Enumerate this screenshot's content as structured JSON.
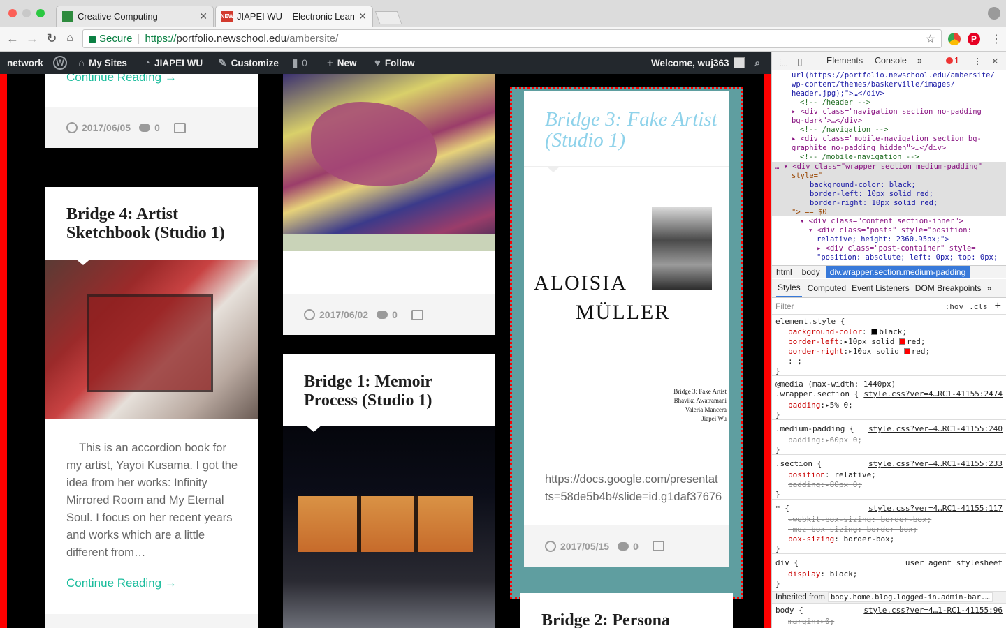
{
  "browser": {
    "tabs": [
      {
        "title": "Creative Computing",
        "favicon_color": "#2e8b3e"
      },
      {
        "title": "JIAPEI WU – Electronic Learning",
        "favicon_text": "NEW",
        "favicon_color": "#d23b2e"
      }
    ],
    "secure_label": "Secure",
    "url_prefix": "https://",
    "url_host": "portfolio.newschool.edu",
    "url_path": "/ambersite/"
  },
  "adminbar": {
    "items": {
      "network": "network",
      "my_sites": "My Sites",
      "site_name": "JIAPEI WU",
      "customize": "Customize",
      "comments_count": "0",
      "new": "New",
      "follow": "Follow"
    },
    "welcome": "Welcome, wuj363"
  },
  "posts": {
    "col1_top": {
      "continue": "Continue Reading →",
      "date": "2017/06/05",
      "comments": "0"
    },
    "bridge4": {
      "title": "Bridge 4: Artist Sketchbook (Studio 1)",
      "excerpt": "This is an accordion book for my artist, Yayoi Kusama. I got the idea from her works: Infinity Mirrored Room and My Eternal Soul. I focus on her recent years and works which are a little different from…",
      "continue": "Continue Reading →"
    },
    "col2_top": {
      "date": "2017/06/02",
      "comments": "0"
    },
    "bridge1": {
      "title": "Bridge 1: Memoir Process (Studio 1)"
    },
    "bridge3": {
      "title": "Bridge 3: Fake Artist (Studio 1)",
      "poster_name_1": "ALOISIA",
      "poster_name_2": "MÜLLER",
      "poster_credits": [
        "Bridge 3: Fake Artist",
        "Bhavika Awatramani",
        "Valeria Mancera",
        "Jiapei Wu"
      ],
      "link_line1": "https://docs.google.com/presentat",
      "link_line2": "ts=58de5b4b#slide=id.g1daf37676",
      "date": "2017/05/15",
      "comments": "0"
    },
    "bridge2": {
      "title": "Bridge 2: Persona"
    }
  },
  "devtools": {
    "tabs": {
      "elements": "Elements",
      "console": "Console",
      "more": "»",
      "errors": "1"
    },
    "dom_lines": [
      "url(https://portfolio.newschool.edu/ambersite/",
      "wp-content/themes/baskerville/images/",
      "header.jpg);\">…</div>",
      "<!-- /header -->",
      "<div class=\"navigation section no-padding",
      "bg-dark\">…</div>",
      "<!-- /navigation -->",
      "<div class=\"mobile-navigation section bg-",
      "graphite no-padding hidden\">…</div>",
      "<!-- /mobile-navigation -->",
      "<div class=\"wrapper section medium-padding\"",
      "style=\"",
      "background-color: black;",
      "border-left: 10px solid red;",
      "border-right: 10px solid red;",
      "\"> == $0",
      "<div class=\"content section-inner\">",
      "<div class=\"posts\" style=\"position:",
      "relative; height: 2360.95px;\">",
      "<div class=\"post-container\" style=",
      "\"position: absolute; left: 0px; top: 0px;"
    ],
    "breadcrumbs": [
      "html",
      "body",
      "div.wrapper.section.medium-padding"
    ],
    "style_tabs": [
      "Styles",
      "Computed",
      "Event Listeners",
      "DOM Breakpoints",
      "»"
    ],
    "filter_placeholder": "Filter",
    "hov": ":hov",
    "cls": ".cls",
    "rules": {
      "element_style": "element.style {",
      "bg_prop": "background-color",
      "bg_val": "black;",
      "bl_prop": "border-left",
      "bl_val": "10px solid",
      "br_prop": "border-right",
      "br_val": "10px solid",
      "red": "red;",
      "media": "@media (max-width: 1440px)",
      "wrapper_sel": ".wrapper.section {",
      "wrapper_src": "style.css?ver=4…RC1-41155:2474",
      "padding_5": "padding",
      "padding_5_val": "5% 0;",
      "medpad_sel": ".medium-padding {",
      "medpad_src": "style.css?ver=4…RC1-41155:240",
      "padding_60_val": "60px 0;",
      "section_sel": ".section {",
      "section_src": "style.css?ver=4…RC1-41155:233",
      "position_prop": "position",
      "position_val": "relative;",
      "padding_80_val": "80px 0;",
      "star_sel": "* {",
      "star_src": "style.css?ver=4…RC1-41155:117",
      "webkit_bs": "-webkit-box-sizing: border-box;",
      "moz_bs": "-moz-box-sizing: border-box;",
      "box_sizing_prop": "box-sizing",
      "box_sizing_val": "border-box;",
      "div_sel": "div {",
      "ua": "user agent stylesheet",
      "display_prop": "display",
      "display_val": "block;",
      "inherited_label": "Inherited from",
      "inherited_from": "body.home.blog.logged-in.admin-bar.…",
      "body_sel": "body {",
      "body_src": "style.css?ver=4…1-RC1-41155:96",
      "margin_prop": "margin",
      "margin_val": "0;",
      "close": "}"
    }
  },
  "colors": {
    "accent": "#1abc9c",
    "highlight_title": "#8ed2ea",
    "teal_bg": "#5f9ea0",
    "red_border": "#ff0000"
  }
}
